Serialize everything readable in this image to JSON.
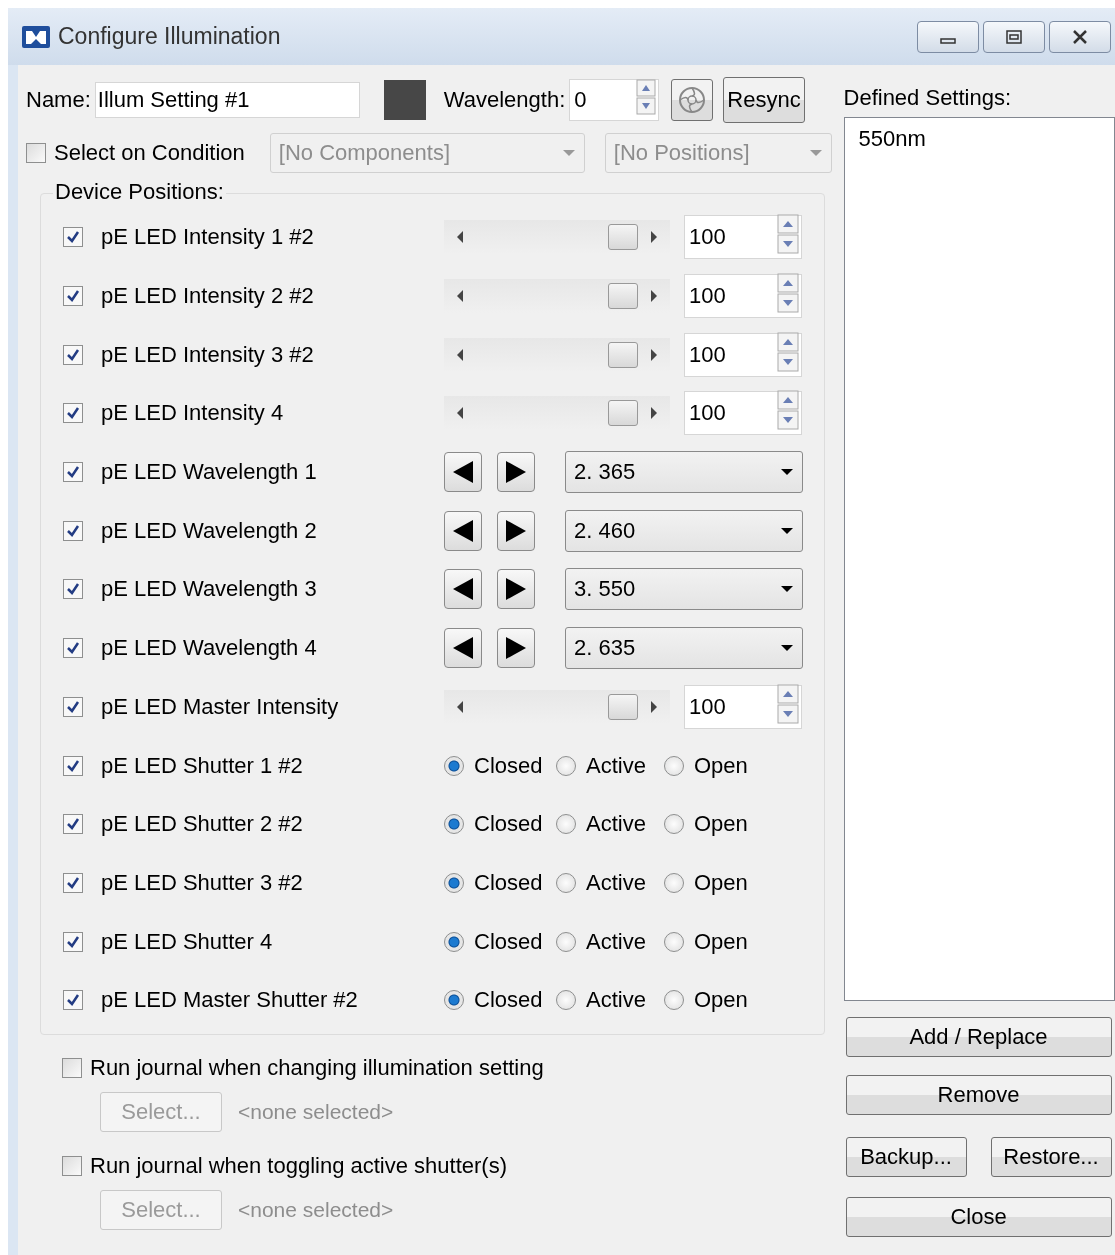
{
  "window": {
    "title": "Configure Illumination"
  },
  "name": {
    "label": "Name:",
    "value": "Illum Setting #1"
  },
  "wavelength": {
    "label": "Wavelength:",
    "value": "0"
  },
  "resync_button": "Resync",
  "select_on_condition": {
    "label": "Select on Condition",
    "checked": false
  },
  "component_dropdown": {
    "value": "[No Components]",
    "disabled": true
  },
  "position_dropdown": {
    "value": "[No Positions]",
    "disabled": true
  },
  "device_positions": {
    "title": "Device Positions:",
    "rows": [
      {
        "kind": "slider",
        "label": "pE LED Intensity 1 #2",
        "checked": true,
        "level": 1,
        "value": "100"
      },
      {
        "kind": "slider",
        "label": "pE LED Intensity 2 #2",
        "checked": true,
        "level": 1,
        "value": "100"
      },
      {
        "kind": "slider",
        "label": "pE LED Intensity 3 #2",
        "checked": true,
        "level": 1,
        "value": "100"
      },
      {
        "kind": "slider",
        "label": "pE LED Intensity 4",
        "checked": true,
        "level": 1,
        "value": "100"
      },
      {
        "kind": "stepper",
        "label": "pE LED Wavelength 1",
        "checked": true,
        "value": "2. 365"
      },
      {
        "kind": "stepper",
        "label": "pE LED Wavelength 2",
        "checked": true,
        "value": "2. 460"
      },
      {
        "kind": "stepper",
        "label": "pE LED Wavelength 3",
        "checked": true,
        "value": "3. 550"
      },
      {
        "kind": "stepper",
        "label": "pE LED Wavelength 4",
        "checked": true,
        "value": "2. 635"
      },
      {
        "kind": "slider",
        "label": "pE LED Master Intensity",
        "checked": true,
        "level": 1,
        "value": "100"
      },
      {
        "kind": "shutter",
        "label": "pE LED Shutter 1 #2",
        "checked": true,
        "options": [
          {
            "label": "Closed",
            "selected": true
          },
          {
            "label": "Active",
            "selected": false
          },
          {
            "label": "Open",
            "selected": false
          }
        ]
      },
      {
        "kind": "shutter",
        "label": "pE LED Shutter 2 #2",
        "checked": true,
        "options": [
          {
            "label": "Closed",
            "selected": true
          },
          {
            "label": "Active",
            "selected": false
          },
          {
            "label": "Open",
            "selected": false
          }
        ]
      },
      {
        "kind": "shutter",
        "label": "pE LED Shutter 3 #2",
        "checked": true,
        "options": [
          {
            "label": "Closed",
            "selected": true
          },
          {
            "label": "Active",
            "selected": false
          },
          {
            "label": "Open",
            "selected": false
          }
        ]
      },
      {
        "kind": "shutter",
        "label": "pE LED Shutter 4",
        "checked": true,
        "options": [
          {
            "label": "Closed",
            "selected": true
          },
          {
            "label": "Active",
            "selected": false
          },
          {
            "label": "Open",
            "selected": false
          }
        ]
      },
      {
        "kind": "shutter",
        "label": "pE LED Master Shutter #2",
        "checked": true,
        "options": [
          {
            "label": "Closed",
            "selected": true
          },
          {
            "label": "Active",
            "selected": false
          },
          {
            "label": "Open",
            "selected": false
          }
        ]
      }
    ]
  },
  "journal_options": [
    {
      "label": "Run journal when changing illumination setting",
      "checked": false,
      "button": "Select...",
      "button_disabled": true,
      "selection": "<none selected>"
    },
    {
      "label": "Run journal when toggling active shutter(s)",
      "checked": false,
      "button": "Select...",
      "button_disabled": true,
      "selection": "<none selected>"
    }
  ],
  "defined_settings": {
    "label": "Defined Settings:",
    "items": [
      "550nm"
    ]
  },
  "buttons": {
    "add_replace": "Add / Replace",
    "remove": "Remove",
    "backup": "Backup...",
    "restore": "Restore...",
    "close": "Close"
  }
}
